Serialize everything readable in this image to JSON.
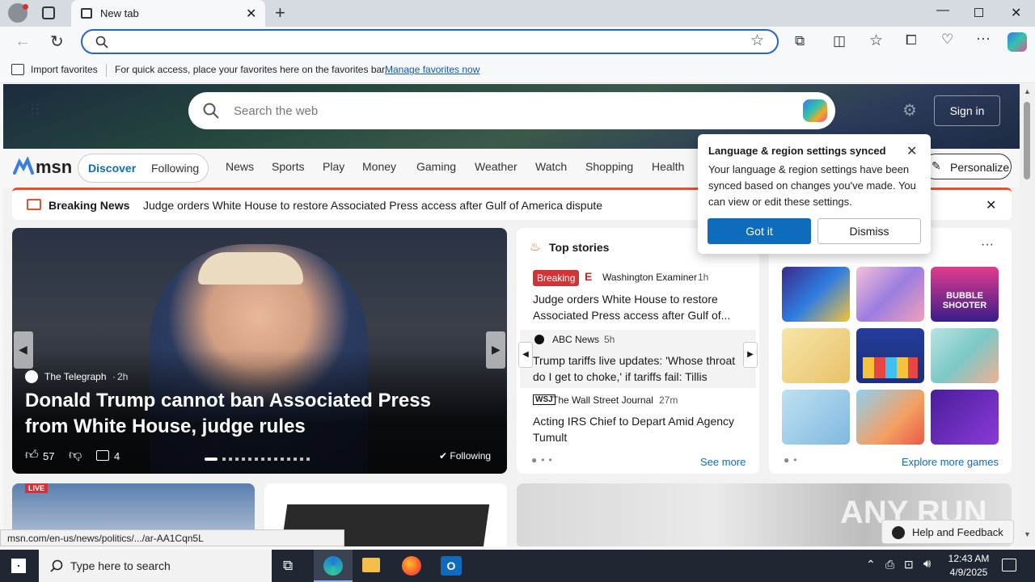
{
  "browser": {
    "tab_title": "New tab",
    "favorites_import": "Import favorites",
    "favorites_hint": "For quick access, place your favorites here on the favorites bar.",
    "favorites_link": "Manage favorites now",
    "status_url": "msn.com/en-us/news/politics/.../ar-AA1Cqn5L"
  },
  "msn": {
    "logo": "msn",
    "search_placeholder": "Search the web",
    "sign_in": "Sign in",
    "tabs": [
      "Discover",
      "Following"
    ],
    "nav": [
      "News",
      "Sports",
      "Play",
      "Money",
      "Gaming",
      "Weather",
      "Watch",
      "Shopping",
      "Health"
    ],
    "personalize": "Personalize",
    "breaking_label": "Breaking News",
    "breaking_text": "Judge orders White House to restore Associated Press access after Gulf of America dispute"
  },
  "hero_story": {
    "source": "The Telegraph",
    "age": "2h",
    "headline": "Donald Trump cannot ban Associated Press from White House, judge rules",
    "likes": "57",
    "comments": "4",
    "following": "Following"
  },
  "top_stories": {
    "title": "Top stories",
    "items": [
      {
        "badge": "Breaking",
        "source": "Washington Examiner",
        "age": "1h",
        "headline": "Judge orders White House to restore Associated Press access after Gulf of..."
      },
      {
        "source": "ABC News",
        "age": "5h",
        "headline": "Trump tariffs live updates: 'Whose throat do I get to choke,' if tariffs fail: Tillis"
      },
      {
        "source": "The Wall Street Journal",
        "age": "27m",
        "headline": "Acting IRS Chief to Depart Amid Agency Tumult"
      }
    ],
    "see_more": "See more"
  },
  "games": {
    "explore": "Explore more games",
    "tiles": [
      "match-3 gems",
      "makeup brushes",
      "Bubble Shooter HD",
      "cat puzzle",
      "block puzzle",
      "hospital story",
      "thief puzzle",
      "character game",
      "crazy games arrow"
    ],
    "bubble_text": "BUBBLE SHOOTER"
  },
  "popup": {
    "title": "Language & region settings synced",
    "body": "Your language & region settings have been synced based on changes you've made. You can view or edit these settings.",
    "primary": "Got it",
    "secondary": "Dismiss"
  },
  "feedback": "Help and Feedback",
  "watermark": "ANY RUN",
  "taskbar": {
    "search_placeholder": "Type here to search",
    "time": "12:43 AM",
    "date": "4/9/2025"
  },
  "colors": {
    "accent": "#0f6cbd",
    "breaking": "#e8502b",
    "badge_red": "#d13438"
  }
}
